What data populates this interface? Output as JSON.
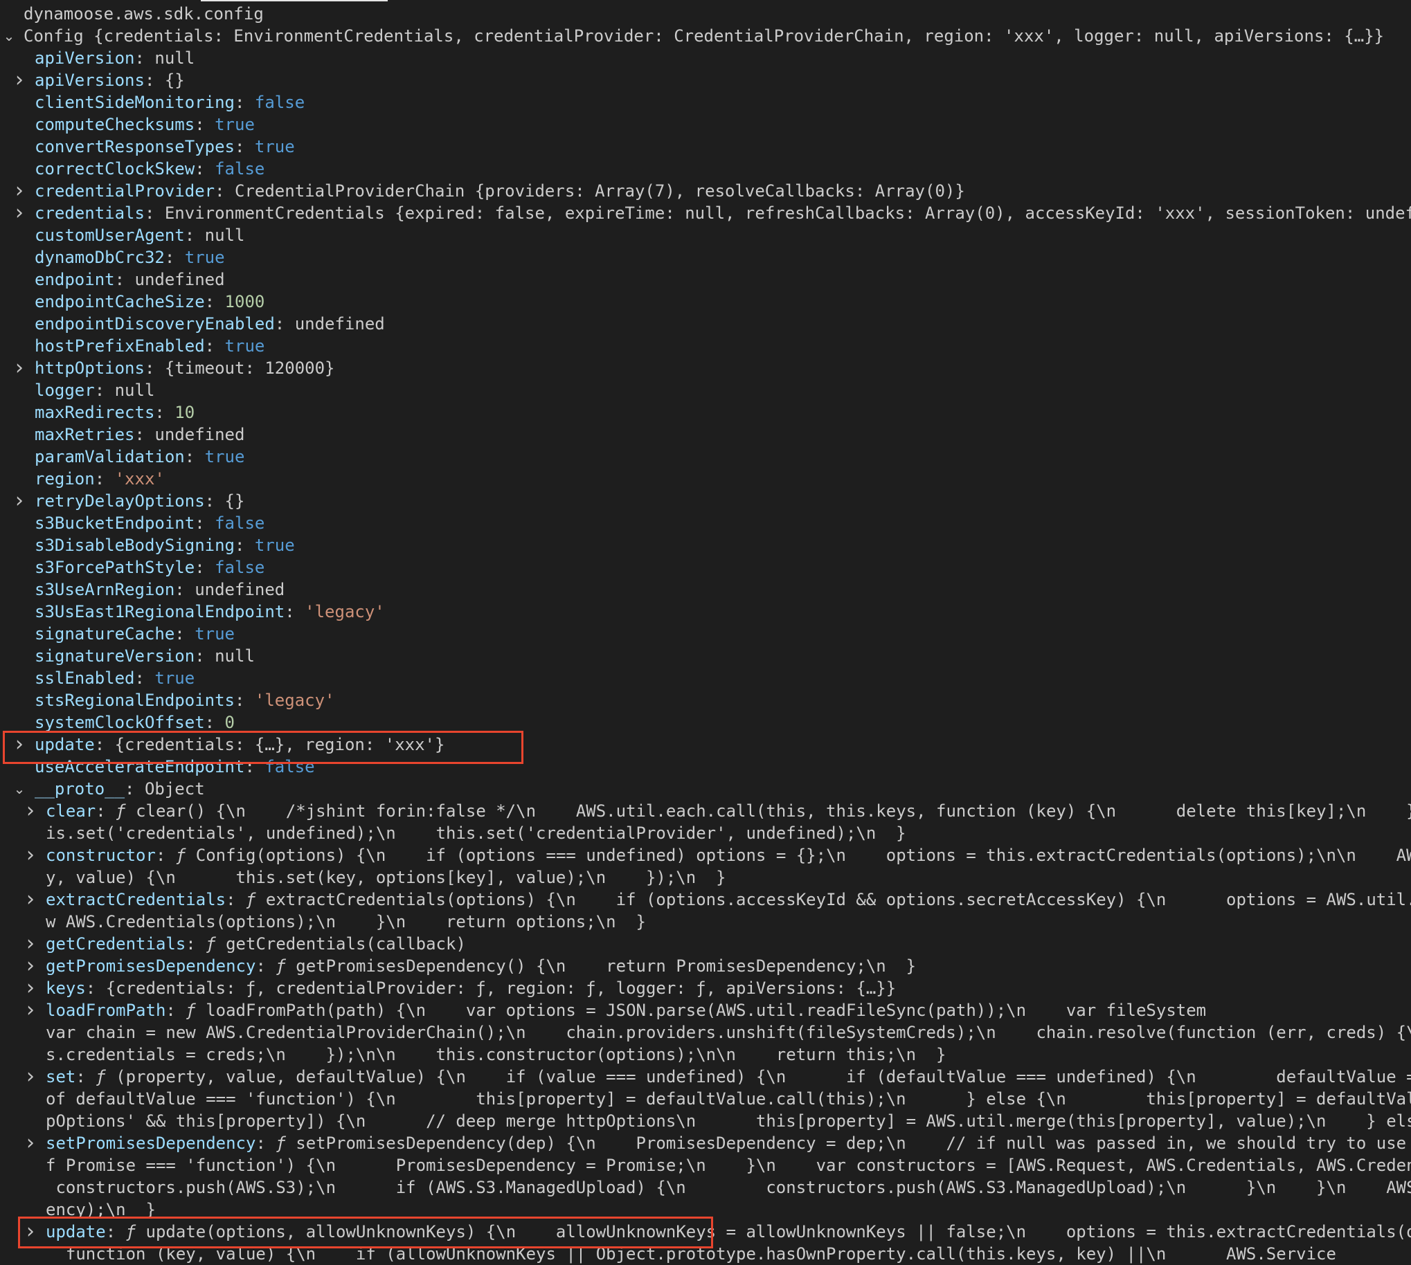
{
  "header": {
    "title": "dynamoose.aws.sdk.config"
  },
  "config_summary": "Config {credentials: EnvironmentCredentials, credentialProvider: CredentialProviderChain, region: 'xxx', logger: null, apiVersions: {…}}",
  "props": [
    {
      "key": "apiVersion",
      "value": "null",
      "type": "plain",
      "expandable": false
    },
    {
      "key": "apiVersions",
      "value": "{}",
      "type": "plain",
      "expandable": true
    },
    {
      "key": "clientSideMonitoring",
      "value": "false",
      "type": "bool",
      "expandable": false
    },
    {
      "key": "computeChecksums",
      "value": "true",
      "type": "bool",
      "expandable": false
    },
    {
      "key": "convertResponseTypes",
      "value": "true",
      "type": "bool",
      "expandable": false
    },
    {
      "key": "correctClockSkew",
      "value": "false",
      "type": "bool",
      "expandable": false
    },
    {
      "key": "credentialProvider",
      "value": "CredentialProviderChain {providers: Array(7), resolveCallbacks: Array(0)}",
      "type": "plain",
      "expandable": true
    },
    {
      "key": "credentials",
      "value": "EnvironmentCredentials {expired: false, expireTime: null, refreshCallbacks: Array(0), accessKeyId: 'xxx', sessionToken: undef",
      "type": "plain",
      "expandable": true
    },
    {
      "key": "customUserAgent",
      "value": "null",
      "type": "plain",
      "expandable": false
    },
    {
      "key": "dynamoDbCrc32",
      "value": "true",
      "type": "bool",
      "expandable": false
    },
    {
      "key": "endpoint",
      "value": "undefined",
      "type": "plain",
      "expandable": false
    },
    {
      "key": "endpointCacheSize",
      "value": "1000",
      "type": "num",
      "expandable": false
    },
    {
      "key": "endpointDiscoveryEnabled",
      "value": "undefined",
      "type": "plain",
      "expandable": false
    },
    {
      "key": "hostPrefixEnabled",
      "value": "true",
      "type": "bool",
      "expandable": false
    },
    {
      "key": "httpOptions",
      "value": "{timeout: 120000}",
      "type": "plain",
      "expandable": true
    },
    {
      "key": "logger",
      "value": "null",
      "type": "plain",
      "expandable": false
    },
    {
      "key": "maxRedirects",
      "value": "10",
      "type": "num",
      "expandable": false
    },
    {
      "key": "maxRetries",
      "value": "undefined",
      "type": "plain",
      "expandable": false
    },
    {
      "key": "paramValidation",
      "value": "true",
      "type": "bool",
      "expandable": false
    },
    {
      "key": "region",
      "value": "'xxx'",
      "type": "str",
      "expandable": false
    },
    {
      "key": "retryDelayOptions",
      "value": "{}",
      "type": "plain",
      "expandable": true
    },
    {
      "key": "s3BucketEndpoint",
      "value": "false",
      "type": "bool",
      "expandable": false
    },
    {
      "key": "s3DisableBodySigning",
      "value": "true",
      "type": "bool",
      "expandable": false
    },
    {
      "key": "s3ForcePathStyle",
      "value": "false",
      "type": "bool",
      "expandable": false
    },
    {
      "key": "s3UseArnRegion",
      "value": "undefined",
      "type": "plain",
      "expandable": false
    },
    {
      "key": "s3UsEast1RegionalEndpoint",
      "value": "'legacy'",
      "type": "str",
      "expandable": false
    },
    {
      "key": "signatureCache",
      "value": "true",
      "type": "bool",
      "expandable": false
    },
    {
      "key": "signatureVersion",
      "value": "null",
      "type": "plain",
      "expandable": false
    },
    {
      "key": "sslEnabled",
      "value": "true",
      "type": "bool",
      "expandable": false
    },
    {
      "key": "stsRegionalEndpoints",
      "value": "'legacy'",
      "type": "str",
      "expandable": false
    },
    {
      "key": "systemClockOffset",
      "value": "0",
      "type": "num",
      "expandable": false
    },
    {
      "key": "update",
      "value": "{credentials: {…}, region: 'xxx'}",
      "type": "plain",
      "expandable": true
    },
    {
      "key": "useAccelerateEndpoint",
      "value": "false",
      "type": "bool",
      "expandable": false
    }
  ],
  "proto_label": "__proto__",
  "proto_value": "Object",
  "proto_lines": [
    {
      "key": "clear",
      "f": true,
      "text": "clear() {\\n    /*jshint forin:false */\\n    AWS.util.each.call(this, this.keys, function (key) {\\n      delete this[key];\\n    }",
      "chevron": true
    },
    {
      "cont": true,
      "text": "is.set('credentials', undefined);\\n    this.set('credentialProvider', undefined);\\n  }"
    },
    {
      "key": "constructor",
      "f": true,
      "text": "Config(options) {\\n    if (options === undefined) options = {};\\n    options = this.extractCredentials(options);\\n\\n    AW",
      "chevron": true
    },
    {
      "cont": true,
      "text": "y, value) {\\n      this.set(key, options[key], value);\\n    });\\n  }"
    },
    {
      "key": "extractCredentials",
      "f": true,
      "text": "extractCredentials(options) {\\n    if (options.accessKeyId && options.secretAccessKey) {\\n      options = AWS.util.",
      "chevron": true
    },
    {
      "cont": true,
      "text": "w AWS.Credentials(options);\\n    }\\n    return options;\\n  }"
    },
    {
      "key": "getCredentials",
      "f": true,
      "text": "getCredentials(callback)",
      "chevron": true
    },
    {
      "key": "getPromisesDependency",
      "f": true,
      "text": "getPromisesDependency() {\\n    return PromisesDependency;\\n  }",
      "chevron": true
    },
    {
      "key": "keys",
      "f": false,
      "text": "{credentials: ƒ, credentialProvider: ƒ, region: ƒ, logger: ƒ, apiVersions: {…}}",
      "chevron": true
    },
    {
      "key": "loadFromPath",
      "f": true,
      "text": "loadFromPath(path) {\\n    var options = JSON.parse(AWS.util.readFileSync(path));\\n    var fileSystem",
      "chevron": true
    },
    {
      "cont": true,
      "text": "var chain = new AWS.CredentialProviderChain();\\n    chain.providers.unshift(fileSystemCreds);\\n    chain.resolve(function (err, creds) {\\"
    },
    {
      "cont": true,
      "text": "s.credentials = creds;\\n    });\\n\\n    this.constructor(options);\\n\\n    return this;\\n  }"
    },
    {
      "key": "set",
      "f": true,
      "text": "(property, value, defaultValue) {\\n    if (value === undefined) {\\n      if (defaultValue === undefined) {\\n        defaultValue =",
      "chevron": true
    },
    {
      "cont": true,
      "text": "of defaultValue === 'function') {\\n        this[property] = defaultValue.call(this);\\n      } else {\\n        this[property] = defaultVal"
    },
    {
      "cont": true,
      "text": "pOptions' && this[property]) {\\n      // deep merge httpOptions\\n      this[property] = AWS.util.merge(this[property], value);\\n    } els"
    },
    {
      "key": "setPromisesDependency",
      "f": true,
      "text": "setPromisesDependency(dep) {\\n    PromisesDependency = dep;\\n    // if null was passed in, we should try to use",
      "chevron": true
    },
    {
      "cont": true,
      "text": "f Promise === 'function') {\\n      PromisesDependency = Promise;\\n    }\\n    var constructors = [AWS.Request, AWS.Credentials, AWS.Creden"
    },
    {
      "cont": true,
      "text": " constructors.push(AWS.S3);\\n      if (AWS.S3.ManagedUpload) {\\n        constructors.push(AWS.S3.ManagedUpload);\\n      }\\n    }\\n    AWS"
    },
    {
      "cont": true,
      "text": "ency);\\n  }"
    },
    {
      "key": "update",
      "f": true,
      "text": "update(options, allowUnknownKeys) {\\n    allowUnknownKeys = allowUnknownKeys || false;\\n    options = this.extractCredentials(o",
      "chevron": true
    },
    {
      "cont": true,
      "text": "  function (key, value) {\\n    if (allowUnknownKeys || Object.prototype.hasOwnProperty.call(this.keys, key) ||\\n      AWS.Service"
    }
  ],
  "colors": {
    "background": "#1e1e1e",
    "key": "#9cdcfe",
    "bool": "#569cd6",
    "number": "#b5cea8",
    "string": "#ce9178",
    "highlight": "#e8452e"
  }
}
